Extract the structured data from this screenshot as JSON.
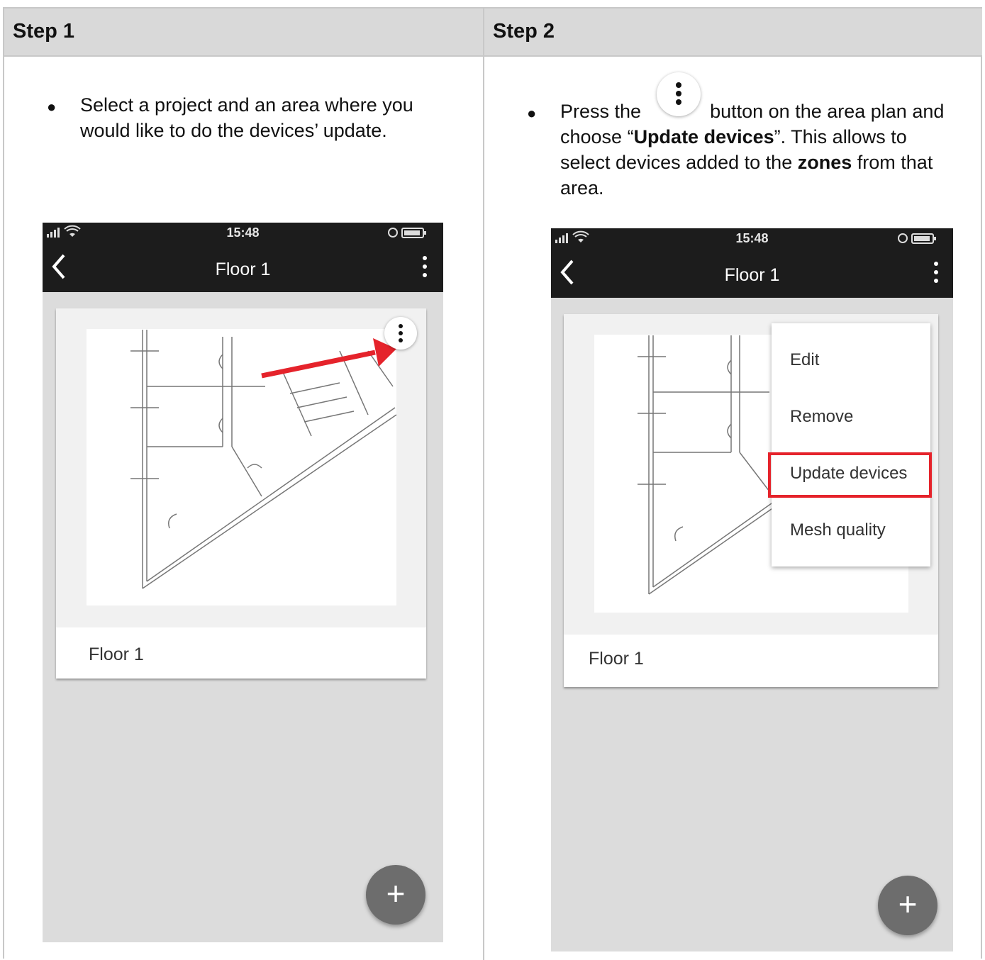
{
  "columns": [
    {
      "header": "Step 1"
    },
    {
      "header": "Step 2"
    }
  ],
  "step1": {
    "instruction": "Select a project and an area where you would like to do the devices’ update.",
    "phone": {
      "time": "15:48",
      "title": "Floor 1",
      "card_label": "Floor 1",
      "fab": "+"
    }
  },
  "step2": {
    "instruction": {
      "press": "Press the",
      "after_icon": "button on the area plan and",
      "choose_open": "choose “",
      "update_devices": "Update devices",
      "choose_close": "”. This allows to",
      "select_devices": "select devices added to the",
      "zones": "zones",
      "from_that": "from that",
      "area": "area."
    },
    "phone": {
      "time": "15:48",
      "title": "Floor 1",
      "card_label": "Floor 1",
      "fab": "+",
      "menu": [
        "Edit",
        "Remove",
        "Update devices",
        "Mesh quality"
      ],
      "highlighted_item": "Update devices"
    }
  },
  "colors": {
    "highlight": "#e5232b",
    "arrow": "#e5232b",
    "header_bg": "#d9d9d9",
    "appbar": "#1c1c1c"
  }
}
